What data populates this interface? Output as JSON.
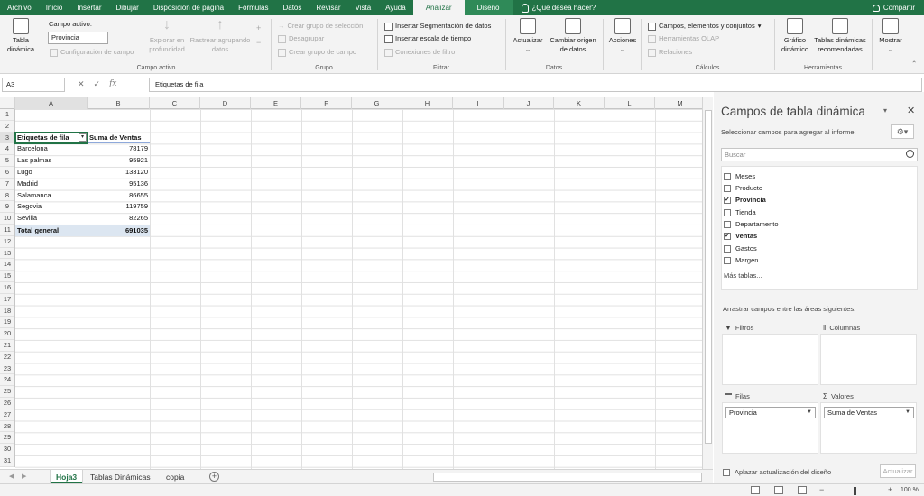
{
  "tabs": [
    "Archivo",
    "Inicio",
    "Insertar",
    "Dibujar",
    "Disposición de página",
    "Fórmulas",
    "Datos",
    "Revisar",
    "Vista",
    "Ayuda",
    "Analizar",
    "Diseño"
  ],
  "tellme": "¿Qué desea hacer?",
  "share": "Compartir",
  "ribbon": {
    "tabla_dinamica": [
      "Tabla",
      "dinámica"
    ],
    "campo_activo_label": "Campo activo:",
    "campo_activo_value": "Provincia",
    "config_campo": "Configuración de campo",
    "explorar": [
      "Explorar en",
      "profundidad"
    ],
    "rastrear": [
      "Rastrear agrupando",
      "datos"
    ],
    "grp_campo_activo": "Campo activo",
    "crear_grupo_sel": "Crear grupo de selección",
    "desagrupar": "Desagrupar",
    "crear_grupo_campo": "Crear grupo de campo",
    "grp_grupo": "Grupo",
    "seg_datos": "Insertar Segmentación de datos",
    "escala_tiempo": "Insertar escala de tiempo",
    "conexiones": "Conexiones de filtro",
    "grp_filtrar": "Filtrar",
    "actualizar": "Actualizar",
    "cambiar_origen": [
      "Cambiar origen",
      "de datos"
    ],
    "grp_datos": "Datos",
    "acciones": "Acciones",
    "campos_elementos": "Campos, elementos y conjuntos",
    "herramientas_olap": "Herramientas OLAP",
    "relaciones": "Relaciones",
    "grp_calculos": "Cálculos",
    "grafico_dinamico": [
      "Gráfico",
      "dinámico"
    ],
    "tablas_recomendadas": [
      "Tablas dinámicas",
      "recomendadas"
    ],
    "grp_herramientas": "Herramientas",
    "mostrar": "Mostrar"
  },
  "formula": {
    "namebox": "A3",
    "fx": "fx",
    "value": "Etiquetas de fila"
  },
  "columns": [
    "A",
    "B",
    "C",
    "D",
    "E",
    "F",
    "G",
    "H",
    "I",
    "J",
    "K",
    "L",
    "M"
  ],
  "rows": [
    "1",
    "2",
    "3",
    "4",
    "5",
    "6",
    "7",
    "8",
    "9",
    "10",
    "11",
    "12",
    "13",
    "14",
    "15",
    "16",
    "17",
    "18",
    "19",
    "20",
    "21",
    "22",
    "23",
    "24",
    "25",
    "26",
    "27",
    "28",
    "29",
    "30",
    "31"
  ],
  "pivot": {
    "header_label": "Etiquetas de fila",
    "header_value": "Suma de Ventas",
    "rows": [
      {
        "label": "Barcelona",
        "value": "78179"
      },
      {
        "label": "Las palmas",
        "value": "95921"
      },
      {
        "label": "Lugo",
        "value": "133120"
      },
      {
        "label": "Madrid",
        "value": "95136"
      },
      {
        "label": "Salamanca",
        "value": "86655"
      },
      {
        "label": "Segovia",
        "value": "119759"
      },
      {
        "label": "Sevilla",
        "value": "82265"
      }
    ],
    "total_label": "Total general",
    "total_value": "691035"
  },
  "sheets": [
    "Hoja3",
    "Tablas Dinámicas",
    "copia"
  ],
  "zoom": "100 %",
  "pane": {
    "title": "Campos de tabla dinámica",
    "subtitle": "Seleccionar campos para agregar al informe:",
    "search_placeholder": "Buscar",
    "fields": [
      {
        "name": "Meses",
        "checked": false
      },
      {
        "name": "Producto",
        "checked": false
      },
      {
        "name": "Provincia",
        "checked": true
      },
      {
        "name": "Tienda",
        "checked": false
      },
      {
        "name": "Departamento",
        "checked": false
      },
      {
        "name": "Ventas",
        "checked": true
      },
      {
        "name": "Gastos",
        "checked": false
      },
      {
        "name": "Margen",
        "checked": false
      }
    ],
    "more_tables": "Más tablas...",
    "drag_hint": "Arrastrar campos entre las áreas siguientes:",
    "filtros": "Filtros",
    "columnas": "Columnas",
    "filas": "Filas",
    "valores": "Valores",
    "filas_value": "Provincia",
    "valores_value": "Suma de Ventas",
    "defer": "Aplazar actualización del diseño",
    "update": "Actualizar"
  }
}
